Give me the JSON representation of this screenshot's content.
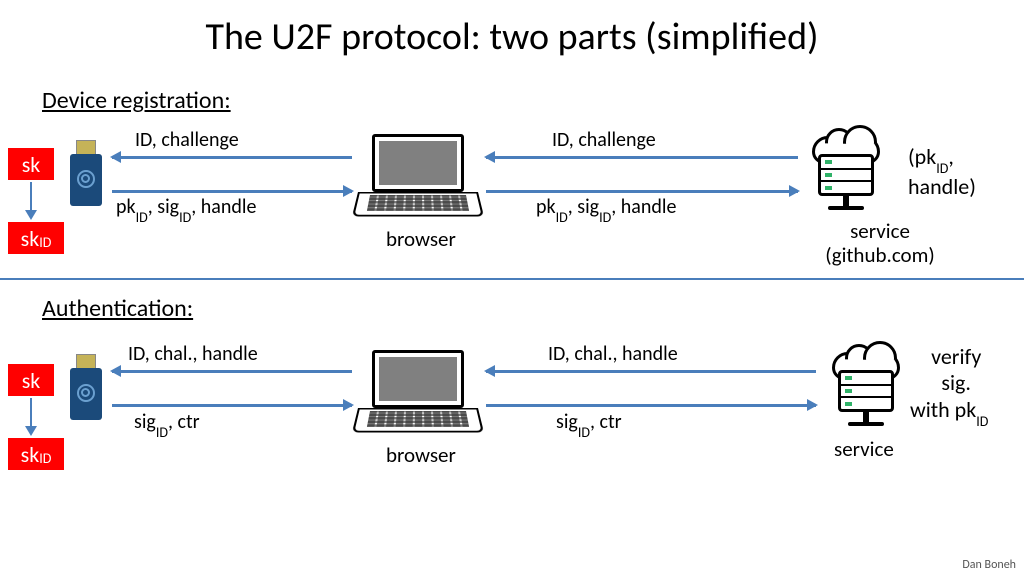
{
  "title": "The U2F protocol:  two parts  (simplified)",
  "author": "Dan Boneh",
  "sections": {
    "registration": "Device registration:",
    "authentication": "Authentication:"
  },
  "labels": {
    "sk": "sk",
    "sk_id_prefix": "sk",
    "sk_id_sub": "ID",
    "browser": "browser",
    "service_reg_l1": "service",
    "service_reg_l2": "(github.com)",
    "service_auth": "service",
    "stores_prefix": "(pk",
    "stores_sub": "ID",
    "stores_suffix": ",",
    "stores_l2": "   handle)",
    "verify_l1": "verify",
    "verify_l2": "sig.",
    "verify_l3_prefix": "with pk",
    "verify_l3_sub": "ID"
  },
  "msgs": {
    "reg_top": "ID,  challenge",
    "reg_bot_prefix": "pk",
    "reg_bot_sub1": "ID",
    "reg_bot_mid": ",  sig",
    "reg_bot_sub2": "ID",
    "reg_bot_suffix": ",  handle",
    "auth_top": "ID,  chal.,  handle",
    "auth_bot_prefix": "sig",
    "auth_bot_sub": "ID",
    "auth_bot_suffix": ",  ctr"
  }
}
